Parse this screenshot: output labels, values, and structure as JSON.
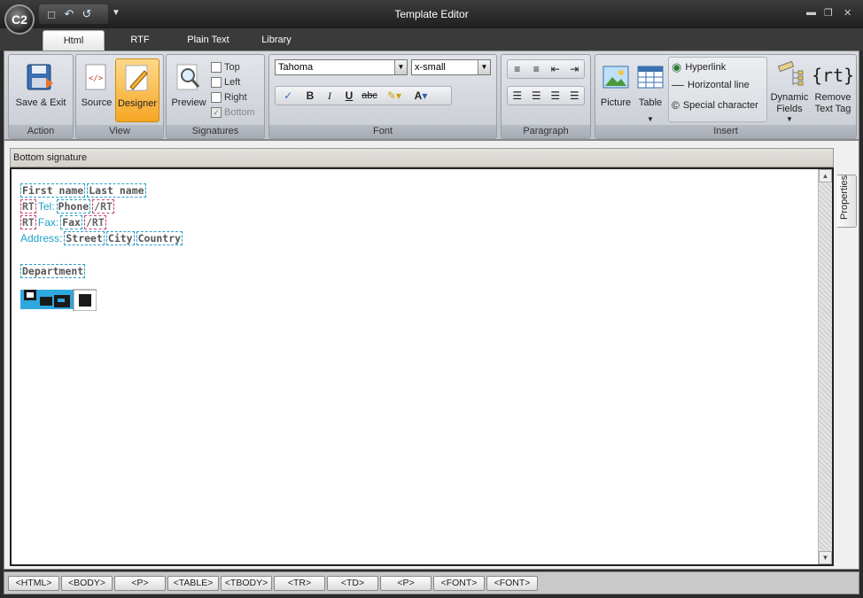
{
  "window": {
    "title": "Template Editor",
    "orb_label": "C2"
  },
  "tabs": [
    "Html",
    "RTF",
    "Plain Text",
    "Library"
  ],
  "ribbon": {
    "action": {
      "label": "Action",
      "save_exit": "Save & Exit"
    },
    "view": {
      "label": "View",
      "source": "Source",
      "designer": "Designer"
    },
    "signatures": {
      "label": "Signatures",
      "preview": "Preview",
      "top": "Top",
      "left": "Left",
      "right": "Right",
      "bottom": "Bottom"
    },
    "font": {
      "label": "Font",
      "family": "Tahoma",
      "size": "x-small",
      "bold": "B",
      "italic": "I",
      "underline": "U",
      "strike": "abc",
      "color": "A"
    },
    "paragraph": {
      "label": "Paragraph"
    },
    "insert": {
      "label": "Insert",
      "picture": "Picture",
      "table": "Table",
      "hyperlink": "Hyperlink",
      "hline": "Horizontal line",
      "special": "Special character",
      "dynamic_1": "Dynamic",
      "dynamic_2": "Fields",
      "remove_1": "Remove",
      "remove_2": "Text Tag",
      "rt_icon": "{rt}"
    }
  },
  "editor": {
    "header": "Bottom signature",
    "props_tab": "Properties",
    "line1": {
      "first": "First name",
      "last": "Last name"
    },
    "line2": {
      "rt_open": "RT",
      "label": "Tel:",
      "field": "Phone",
      "rt_close": "/RT"
    },
    "line3": {
      "rt_open": "RT",
      "label": "Fax:",
      "field": "Fax",
      "rt_close": "/RT"
    },
    "line4": {
      "label": "Address:",
      "street": "Street",
      "city": "City",
      "country": "Country"
    },
    "line5": {
      "dept": "Department"
    }
  },
  "tag_path": [
    "<HTML>",
    "<BODY>",
    "<P>",
    "<TABLE>",
    "<TBODY>",
    "<TR>",
    "<TD>",
    "<P>",
    "<FONT>",
    "<FONT>"
  ]
}
